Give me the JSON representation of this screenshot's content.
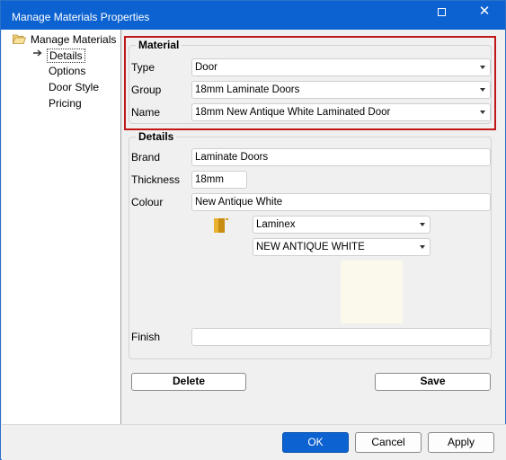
{
  "window": {
    "title": "Manage Materials Properties"
  },
  "tree": {
    "root": "Manage Materials",
    "items": [
      {
        "label": "Details",
        "selected": true
      },
      {
        "label": "Options",
        "selected": false
      },
      {
        "label": "Door Style",
        "selected": false
      },
      {
        "label": "Pricing",
        "selected": false
      }
    ]
  },
  "material": {
    "title": "Material",
    "type_label": "Type",
    "type_value": "Door",
    "group_label": "Group",
    "group_value": "18mm Laminate Doors",
    "name_label": "Name",
    "name_value": "18mm New Antique White Laminated Door"
  },
  "details": {
    "title": "Details",
    "brand_label": "Brand",
    "brand_value": "Laminate Doors",
    "thickness_label": "Thickness",
    "thickness_value": "18mm",
    "colour_label": "Colour",
    "colour_value": "New Antique White",
    "supplier_value": "Laminex",
    "colour_code_value": "NEW ANTIQUE WHITE",
    "finish_label": "Finish",
    "finish_value": "",
    "swatch_color": "#fbf9ec"
  },
  "actions": {
    "delete_label": "Delete",
    "save_label": "Save"
  },
  "footer": {
    "ok_label": "OK",
    "cancel_label": "Cancel",
    "apply_label": "Apply"
  },
  "colors": {
    "accent": "#0c62d0",
    "highlight_border": "#c01818"
  },
  "icons": {
    "maximize": "maximize-icon",
    "close": "close-icon",
    "folder": "folder-open-icon",
    "arrow": "arrow-right-icon",
    "laminex": "laminex-logo-icon",
    "dropdown": "chevron-down-icon"
  }
}
